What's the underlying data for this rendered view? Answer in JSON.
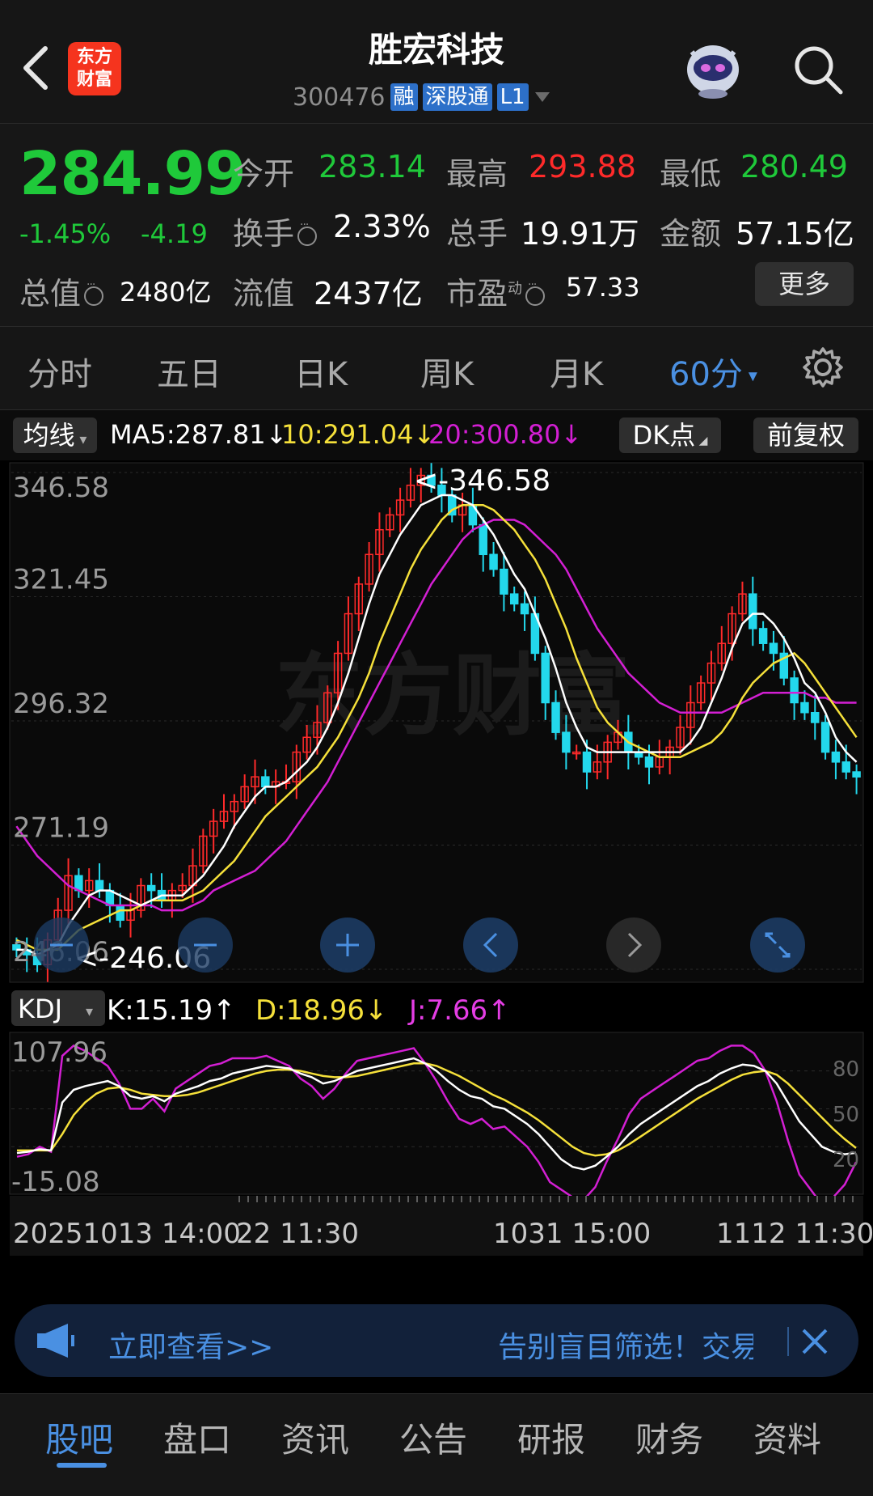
{
  "header": {
    "logo_line1": "东方",
    "logo_line2": "财富",
    "title": "胜宏科技",
    "code": "300476",
    "tag1": "融",
    "tag2": "深股通",
    "tag3": "L1"
  },
  "quote": {
    "price": "284.99",
    "change_pct": "-1.45%",
    "change": "-4.19",
    "open_label": "今开",
    "open": "283.14",
    "high_label": "最高",
    "high": "293.88",
    "low_label": "最低",
    "low": "280.49",
    "turnover_label": "换手",
    "turnover": "2.33%",
    "volume_label": "总手",
    "volume": "19.91万",
    "amount_label": "金额",
    "amount": "57.15亿",
    "mktcap_label": "总值",
    "mktcap": "2480亿",
    "float_label": "流值",
    "float": "2437亿",
    "pe_label": "市盈",
    "pe_sup": "动",
    "pe": "57.33",
    "more": "更多"
  },
  "period_tabs": [
    "分时",
    "五日",
    "日K",
    "周K",
    "月K",
    "60分"
  ],
  "active_period": "60分",
  "indicator_bar": {
    "ma_selector": "均线",
    "ma5": "MA5:287.81↓",
    "ma10": "10:291.04↓",
    "ma20": "20:300.80↓",
    "dk": "DK点",
    "adjust": "前复权"
  },
  "chart_data": {
    "type": "candlestick",
    "y_ticks": [
      "346.58",
      "321.45",
      "296.32",
      "271.19",
      "246.06"
    ],
    "ylim": [
      246.06,
      346.58
    ],
    "max_label": "<-346.58",
    "min_label": "<-246.06",
    "watermark": "东方财富",
    "closes": [
      250,
      249,
      247,
      252,
      258,
      265,
      262,
      264,
      262,
      259,
      256,
      258,
      263,
      262,
      260,
      262,
      263,
      267,
      273,
      276,
      278,
      280,
      283,
      285,
      283,
      284,
      284,
      290,
      293,
      296,
      302,
      310,
      318,
      324,
      330,
      335,
      338,
      341,
      344,
      346,
      344,
      342,
      338,
      340,
      336,
      330,
      327,
      322,
      320,
      318,
      310,
      300,
      294,
      290,
      290,
      286,
      288,
      292,
      294,
      290,
      289,
      287,
      289,
      291,
      295,
      300,
      304,
      308,
      312,
      318,
      322,
      315,
      312,
      310,
      305,
      300,
      298,
      296,
      290,
      288,
      286,
      284.99
    ],
    "ma5": [
      250,
      250,
      249,
      250,
      251,
      255,
      258,
      261,
      262,
      262,
      261,
      260,
      259,
      260,
      261,
      261,
      261,
      263,
      265,
      268,
      271,
      275,
      278,
      281,
      283,
      283,
      284,
      286,
      288,
      291,
      295,
      300,
      306,
      313,
      320,
      326,
      330,
      334,
      337,
      340,
      341,
      342,
      342,
      341,
      340,
      337,
      334,
      330,
      326,
      323,
      318,
      313,
      307,
      300,
      295,
      291,
      290,
      290,
      290,
      290,
      290,
      290,
      290,
      290,
      290,
      292,
      295,
      300,
      305,
      311,
      316,
      318,
      318,
      316,
      313,
      309,
      304,
      302,
      298,
      293,
      290,
      288
    ],
    "ma10": [
      252,
      251,
      250,
      250,
      250,
      252,
      254,
      255,
      256,
      257,
      258,
      258,
      259,
      260,
      260,
      260,
      260,
      261,
      262,
      264,
      266,
      268,
      271,
      274,
      277,
      279,
      281,
      283,
      285,
      287,
      290,
      293,
      297,
      301,
      306,
      312,
      317,
      322,
      327,
      331,
      334,
      337,
      339,
      340,
      340,
      340,
      339,
      337,
      335,
      332,
      329,
      325,
      320,
      315,
      309,
      304,
      299,
      296,
      294,
      292,
      291,
      290,
      289,
      289,
      289,
      290,
      291,
      292,
      294,
      297,
      301,
      304,
      306,
      308,
      309,
      310,
      308,
      305,
      302,
      299,
      296,
      293
    ],
    "ma20": [
      275,
      272,
      269,
      267,
      265,
      263,
      262,
      261,
      260,
      259,
      259,
      259,
      259,
      259,
      258,
      258,
      258,
      259,
      260,
      262,
      263,
      264,
      265,
      266,
      268,
      270,
      272,
      275,
      278,
      281,
      284,
      288,
      292,
      296,
      300,
      304,
      308,
      312,
      316,
      320,
      324,
      327,
      330,
      333,
      335,
      336,
      337,
      337,
      337,
      336,
      334,
      332,
      330,
      327,
      323,
      319,
      315,
      312,
      309,
      306,
      304,
      302,
      300,
      299,
      298,
      298,
      298,
      298,
      298,
      299,
      300,
      301,
      302,
      302,
      302,
      302,
      302,
      301,
      301,
      300,
      300,
      300
    ],
    "kdj_label": "KDJ",
    "k": "K:15.19↑",
    "d": "D:18.96↓",
    "j": "J:7.66↑",
    "kdj_ticks": [
      "107.96",
      "-15.08"
    ],
    "kdj_right_ticks": [
      "80",
      "50",
      "20"
    ],
    "kdj_ylim": [
      -15.08,
      107.96
    ],
    "k_values": [
      15,
      16,
      18,
      17,
      55,
      65,
      68,
      70,
      72,
      68,
      60,
      58,
      60,
      56,
      62,
      65,
      68,
      72,
      74,
      78,
      80,
      82,
      84,
      83,
      82,
      78,
      75,
      70,
      72,
      76,
      80,
      82,
      84,
      86,
      88,
      90,
      86,
      80,
      72,
      65,
      60,
      58,
      52,
      50,
      44,
      38,
      30,
      20,
      10,
      4,
      2,
      5,
      12,
      20,
      30,
      38,
      44,
      50,
      56,
      62,
      68,
      72,
      78,
      82,
      85,
      84,
      80,
      70,
      55,
      40,
      30,
      20,
      16,
      14,
      15.19
    ],
    "d_values": [
      17,
      17,
      17,
      17,
      30,
      45,
      55,
      62,
      66,
      67,
      65,
      62,
      61,
      60,
      60,
      61,
      63,
      66,
      69,
      72,
      75,
      78,
      80,
      81,
      81,
      80,
      78,
      76,
      75,
      75,
      76,
      78,
      80,
      82,
      84,
      86,
      86,
      84,
      80,
      76,
      71,
      66,
      61,
      57,
      52,
      47,
      41,
      34,
      27,
      20,
      15,
      13,
      14,
      17,
      22,
      28,
      34,
      40,
      46,
      52,
      58,
      63,
      68,
      73,
      77,
      79,
      80,
      77,
      70,
      61,
      52,
      43,
      34,
      26,
      18.96
    ],
    "j_values": [
      12,
      14,
      20,
      16,
      92,
      100,
      96,
      90,
      84,
      70,
      50,
      50,
      58,
      48,
      66,
      72,
      78,
      84,
      86,
      90,
      90,
      90,
      92,
      88,
      84,
      74,
      68,
      58,
      66,
      78,
      88,
      90,
      92,
      94,
      96,
      98,
      86,
      72,
      56,
      42,
      38,
      42,
      34,
      36,
      28,
      20,
      8,
      -8,
      -14,
      -20,
      -22,
      -12,
      8,
      26,
      46,
      58,
      64,
      70,
      76,
      82,
      88,
      90,
      96,
      100,
      100,
      94,
      80,
      56,
      25,
      -2,
      -14,
      -26,
      -20,
      -10,
      7.66
    ],
    "x_labels": [
      "20251013 14:00",
      "22 11:30",
      "1031 15:00",
      "1112 11:30"
    ]
  },
  "chart_controls": [
    "minus",
    "minus",
    "plus",
    "left",
    "right",
    "expand"
  ],
  "banner": {
    "left": "立即查看>>",
    "right": "告别盲目筛选！交易"
  },
  "bottom_tabs": [
    "股吧",
    "盘口",
    "资讯",
    "公告",
    "研报",
    "财务",
    "资料"
  ],
  "active_bottom": "股吧",
  "colors": {
    "up": "#ff2a2a",
    "down": "#1fc93a",
    "accent": "#4a90e2",
    "ma5": "#ffffff",
    "ma10": "#f5e03a",
    "ma20": "#d31fd3",
    "candle_down_fill": "#23d8ec"
  }
}
